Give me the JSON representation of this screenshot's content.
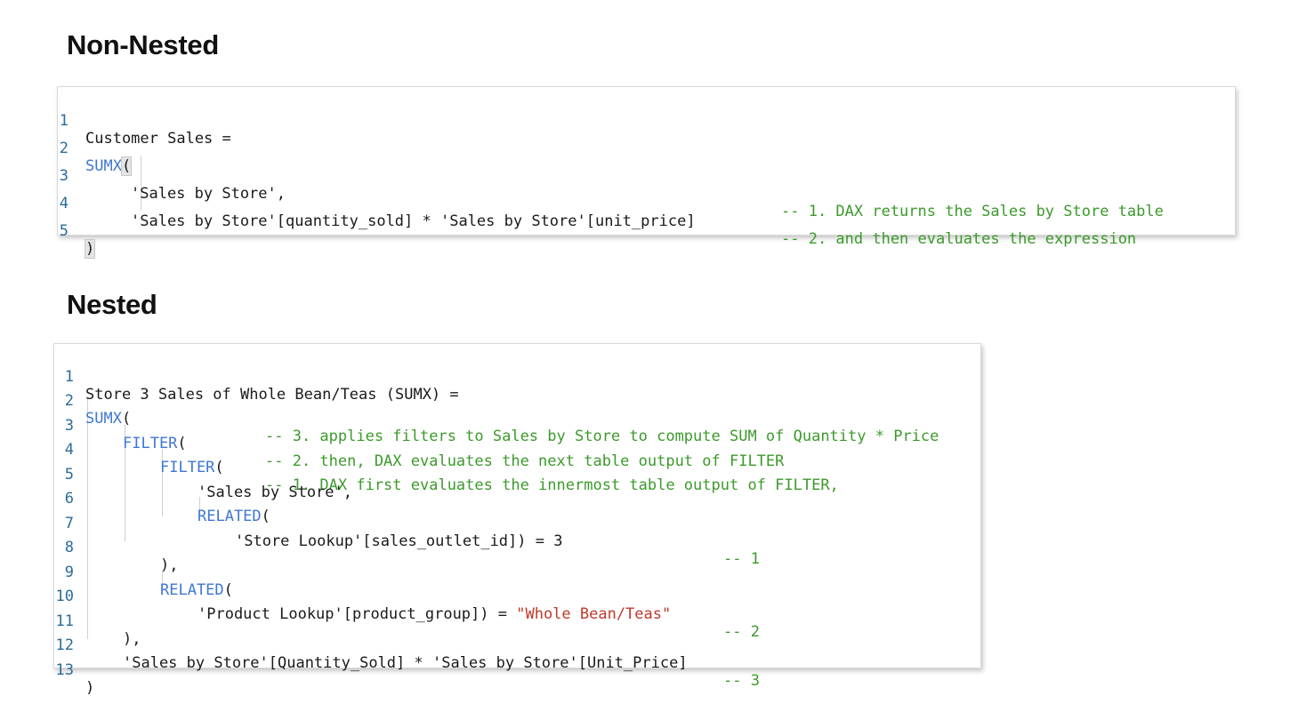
{
  "sections": {
    "non_nested": {
      "title": "Non-Nested"
    },
    "nested": {
      "title": "Nested"
    }
  },
  "block1": {
    "lines": [
      {
        "num": "1",
        "code": "Customer Sales ="
      },
      {
        "num": "2",
        "kw": "SUMX",
        "code": "("
      },
      {
        "num": "3",
        "code": "'Sales by Store',",
        "comment": "-- 1. DAX returns the Sales by Store table"
      },
      {
        "num": "4",
        "code": "'Sales by Store'[quantity_sold] * 'Sales by Store'[unit_price]",
        "comment": "-- 2. and then evaluates the expression"
      },
      {
        "num": "5",
        "code": ")"
      }
    ]
  },
  "block2": {
    "lines": [
      {
        "num": "1",
        "code": "Store 3 Sales of Whole Bean/Teas (SUMX) ="
      },
      {
        "num": "2",
        "kw": "SUMX",
        "code": "(",
        "comment": "-- 3. applies filters to Sales by Store to compute SUM of Quantity * Price"
      },
      {
        "num": "3",
        "kw": "FILTER",
        "code": "(",
        "comment": "-- 2. then, DAX evaluates the next table output of FILTER"
      },
      {
        "num": "4",
        "kw": "FILTER",
        "code": "(",
        "comment": "-- 1. DAX first evaluates the innermost table output of FILTER,"
      },
      {
        "num": "5",
        "code": "'Sales by Store',"
      },
      {
        "num": "6",
        "kw": "RELATED",
        "code": "("
      },
      {
        "num": "7",
        "code": "'Store Lookup'[sales_outlet_id]) = 3",
        "comment": "-- 1"
      },
      {
        "num": "8",
        "code": "),"
      },
      {
        "num": "9",
        "kw": "RELATED",
        "code": "("
      },
      {
        "num": "10",
        "code": "'Product Lookup'[product_group]) = ",
        "str": "\"Whole Bean/Teas\"",
        "comment": "-- 2"
      },
      {
        "num": "11",
        "code": "),"
      },
      {
        "num": "12",
        "code": "'Sales by Store'[Quantity_Sold] * 'Sales by Store'[Unit_Price]",
        "comment": "-- 3"
      },
      {
        "num": "13",
        "code": ")"
      }
    ]
  }
}
